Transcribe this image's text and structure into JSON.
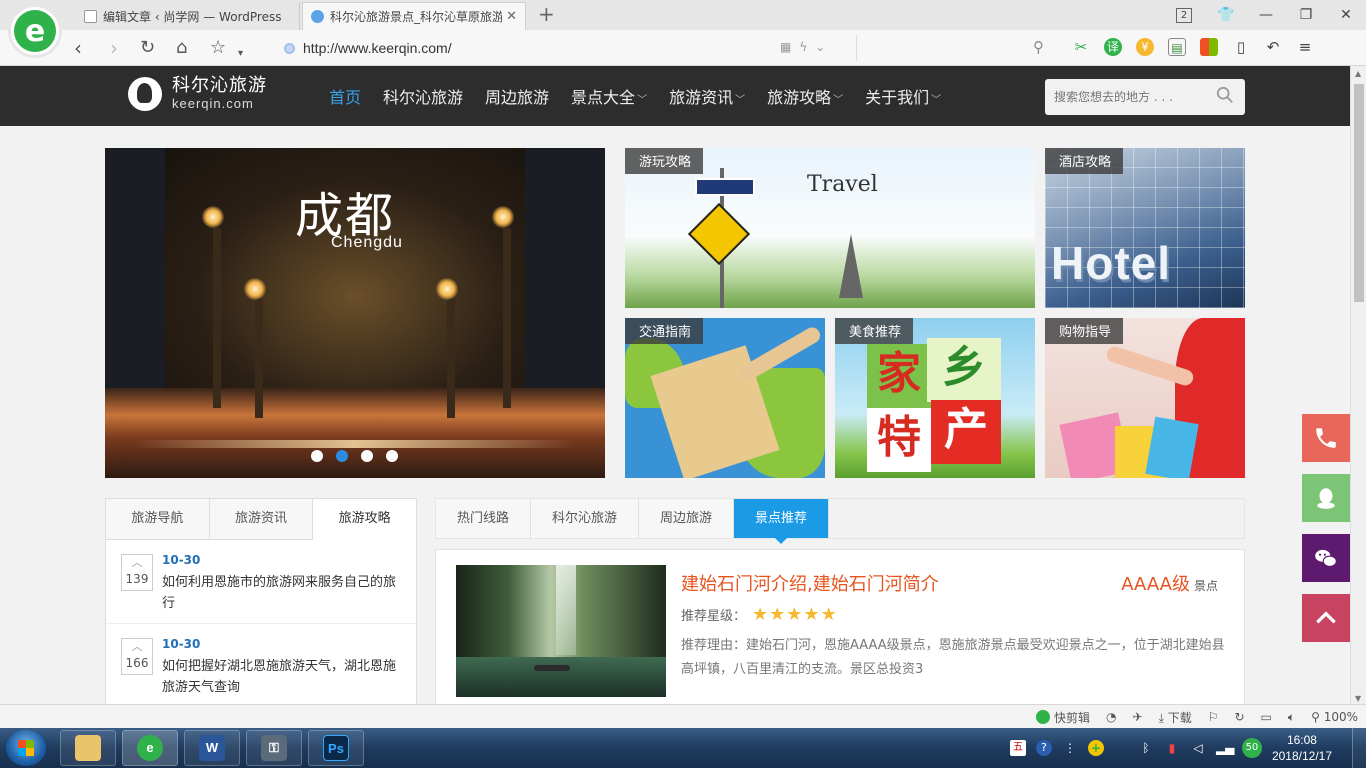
{
  "browser": {
    "tabs": [
      {
        "label": "编辑文章 ‹ 尚学网 — WordPress",
        "active": false
      },
      {
        "label": "科尔沁旅游景点_科尔沁草原旅游",
        "active": true
      }
    ],
    "tab_count": "2",
    "url": "http://www.keerqin.com/"
  },
  "site": {
    "logo_cn": "科尔沁旅游",
    "logo_en": "keerqin.com",
    "nav": [
      {
        "label": "首页",
        "dropdown": false,
        "active": true
      },
      {
        "label": "科尔沁旅游",
        "dropdown": false
      },
      {
        "label": "周边旅游",
        "dropdown": false
      },
      {
        "label": "景点大全",
        "dropdown": true
      },
      {
        "label": "旅游资讯",
        "dropdown": true
      },
      {
        "label": "旅游攻略",
        "dropdown": true
      },
      {
        "label": "关于我们",
        "dropdown": true
      }
    ],
    "search_placeholder": "搜索您想去的地方 . . ."
  },
  "banner": {
    "title_cn": "成都",
    "title_en": "Chengdu",
    "dots": 4,
    "active_dot": 2
  },
  "tiles": {
    "travel": {
      "label": "游玩攻略",
      "text": "Travel"
    },
    "hotel": {
      "label": "酒店攻略",
      "text": "Hotel"
    },
    "traffic": {
      "label": "交通指南"
    },
    "food": {
      "label": "美食推荐",
      "chars": [
        "家",
        "乡",
        "特",
        "产"
      ]
    },
    "shop": {
      "label": "购物指导"
    }
  },
  "left_panel": {
    "tabs": [
      "旅游导航",
      "旅游资讯",
      "旅游攻略"
    ],
    "active_tab": 2,
    "items": [
      {
        "count": "139",
        "date": "10-30",
        "title": "如何利用恩施市的旅游网来服务自己的旅行"
      },
      {
        "count": "166",
        "date": "10-30",
        "title": "如何把握好湖北恩施旅游天气，湖北恩施旅游天气查询"
      }
    ]
  },
  "right_panel": {
    "tabs": [
      "热门线路",
      "科尔沁旅游",
      "周边旅游",
      "景点推荐"
    ],
    "active_tab": 3,
    "card": {
      "title": "建始石门河介绍,建始石门河简介",
      "grade": "AAAA级",
      "grade_suffix": "景点",
      "stars_label": "推荐星级：",
      "stars": "★★★★★",
      "reason": "推荐理由：建始石门河，恩施AAAA级景点，恩施旅游景点最受欢迎景点之一，位于湖北建始县高坪镇，八百里清江的支流。景区总投资3"
    }
  },
  "statusbar": {
    "kuaijianji": "快剪辑",
    "download": "下载",
    "zoom": "100%"
  },
  "taskbar": {
    "time": "16:08",
    "date": "2018/12/17",
    "tray_badge": "50"
  },
  "colors": {
    "header_bg": "#2d2d2d",
    "nav_active": "#3aa0e8",
    "tab_active": "#1b9ae6",
    "accent_orange": "#e8541f"
  }
}
